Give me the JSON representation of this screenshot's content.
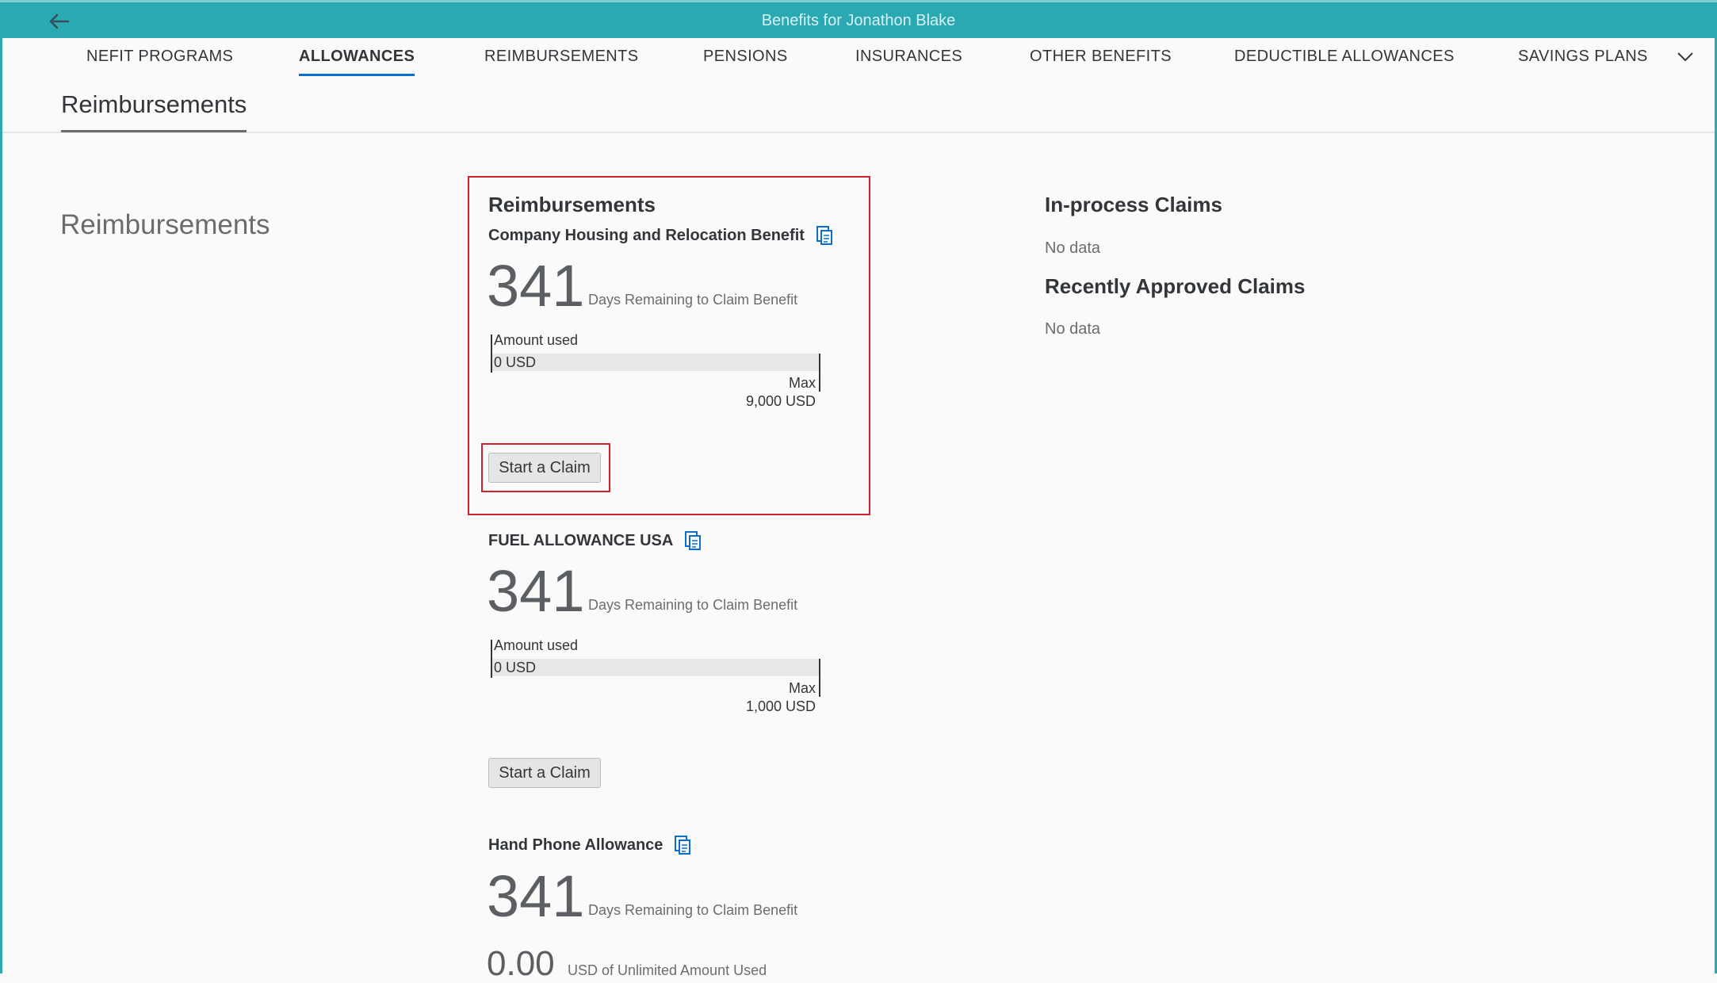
{
  "shell": {
    "title": "Benefits for Jonathon Blake"
  },
  "tabs": [
    {
      "label": "NEFIT PROGRAMS",
      "active": false
    },
    {
      "label": "ALLOWANCES",
      "active": true
    },
    {
      "label": "REIMBURSEMENTS",
      "active": false
    },
    {
      "label": "PENSIONS",
      "active": false
    },
    {
      "label": "INSURANCES",
      "active": false
    },
    {
      "label": "OTHER BENEFITS",
      "active": false
    },
    {
      "label": "DEDUCTIBLE ALLOWANCES",
      "active": false
    },
    {
      "label": "SAVINGS PLANS",
      "active": false
    }
  ],
  "section": {
    "tab_label": "Reimbursements",
    "side_title": "Reimbursements",
    "card_heading": "Reimbursements"
  },
  "benefits": [
    {
      "name": "Company Housing and Relocation Benefit",
      "days": "341",
      "days_label": "Days Remaining to Claim Benefit",
      "amount_label": "Amount used",
      "amount_value": "0 USD",
      "used_fraction": 0,
      "max_label": "Max",
      "max_value": "9,000 USD",
      "button_label": "Start a Claim"
    },
    {
      "name": "FUEL ALLOWANCE USA",
      "days": "341",
      "days_label": "Days Remaining to Claim Benefit",
      "amount_label": "Amount used",
      "amount_value": "0 USD",
      "used_fraction": 0,
      "max_label": "Max",
      "max_value": "1,000 USD",
      "button_label": "Start a Claim"
    },
    {
      "name": "Hand Phone Allowance",
      "days": "341",
      "days_label": "Days Remaining to Claim Benefit",
      "used_value": "0.00",
      "used_label": "USD of Unlimited Amount Used"
    }
  ],
  "claims": {
    "in_process_title": "In-process Claims",
    "in_process_empty": "No data",
    "approved_title": "Recently Approved Claims",
    "approved_empty": "No data"
  },
  "colors": {
    "shell_bar": "#2aa9b3",
    "active_tab_underline": "#0a6ed1",
    "highlight_border": "#d0222d"
  },
  "icons": {
    "back": "arrow-left-icon",
    "overflow": "chevron-down-icon",
    "document": "copy-document-icon"
  }
}
